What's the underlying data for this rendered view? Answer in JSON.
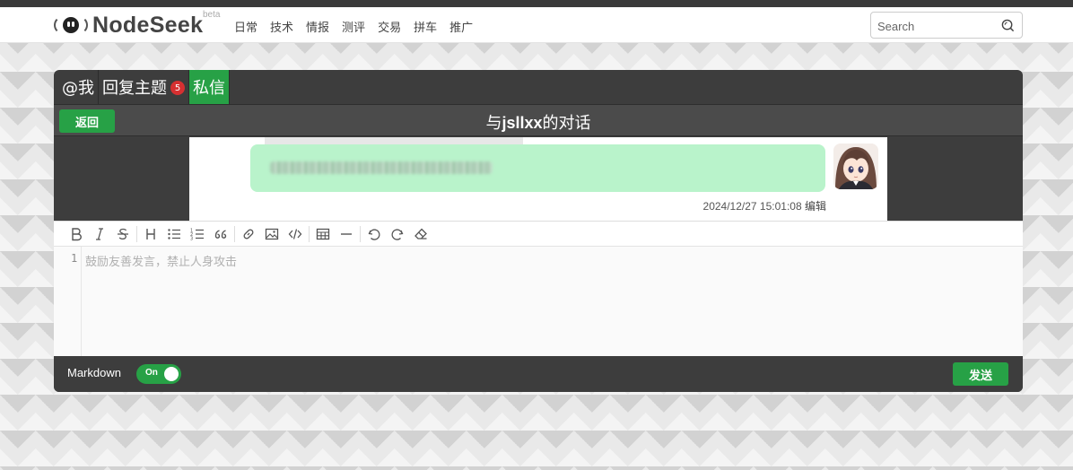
{
  "site": {
    "name": "NodeSeek",
    "beta": "beta"
  },
  "nav": [
    "日常",
    "技术",
    "情报",
    "测评",
    "交易",
    "拼车",
    "推广"
  ],
  "search": {
    "placeholder": "Search",
    "value": ""
  },
  "tabs": [
    {
      "label": "@我",
      "active": false
    },
    {
      "label": "回复主题",
      "active": false,
      "badge": "5"
    },
    {
      "label": "私信",
      "active": true
    }
  ],
  "conversation": {
    "back_label": "返回",
    "title_prefix": "与",
    "username": "jsllxx",
    "title_suffix": "的对话"
  },
  "message": {
    "timestamp": "2024/12/27 15:01:08",
    "edit_label": "编辑"
  },
  "toolbar": [
    "bold-icon",
    "italic-icon",
    "strikethrough-icon",
    "heading-icon",
    "unordered-list-icon",
    "ordered-list-icon",
    "quote-icon",
    "link-icon",
    "image-icon",
    "code-icon",
    "table-icon",
    "horizontal-rule-icon",
    "undo-icon",
    "redo-icon",
    "eraser-icon"
  ],
  "editor": {
    "line_number": "1",
    "placeholder": "鼓励友善发言，禁止人身攻击"
  },
  "footer": {
    "markdown_label": "Markdown",
    "toggle_label": "On",
    "markdown_enabled": true,
    "send_label": "发送"
  },
  "colors": {
    "accent": "#27a146",
    "bubble": "#b9f3cb",
    "badge": "#d63031",
    "panel": "#3d3d3d"
  }
}
